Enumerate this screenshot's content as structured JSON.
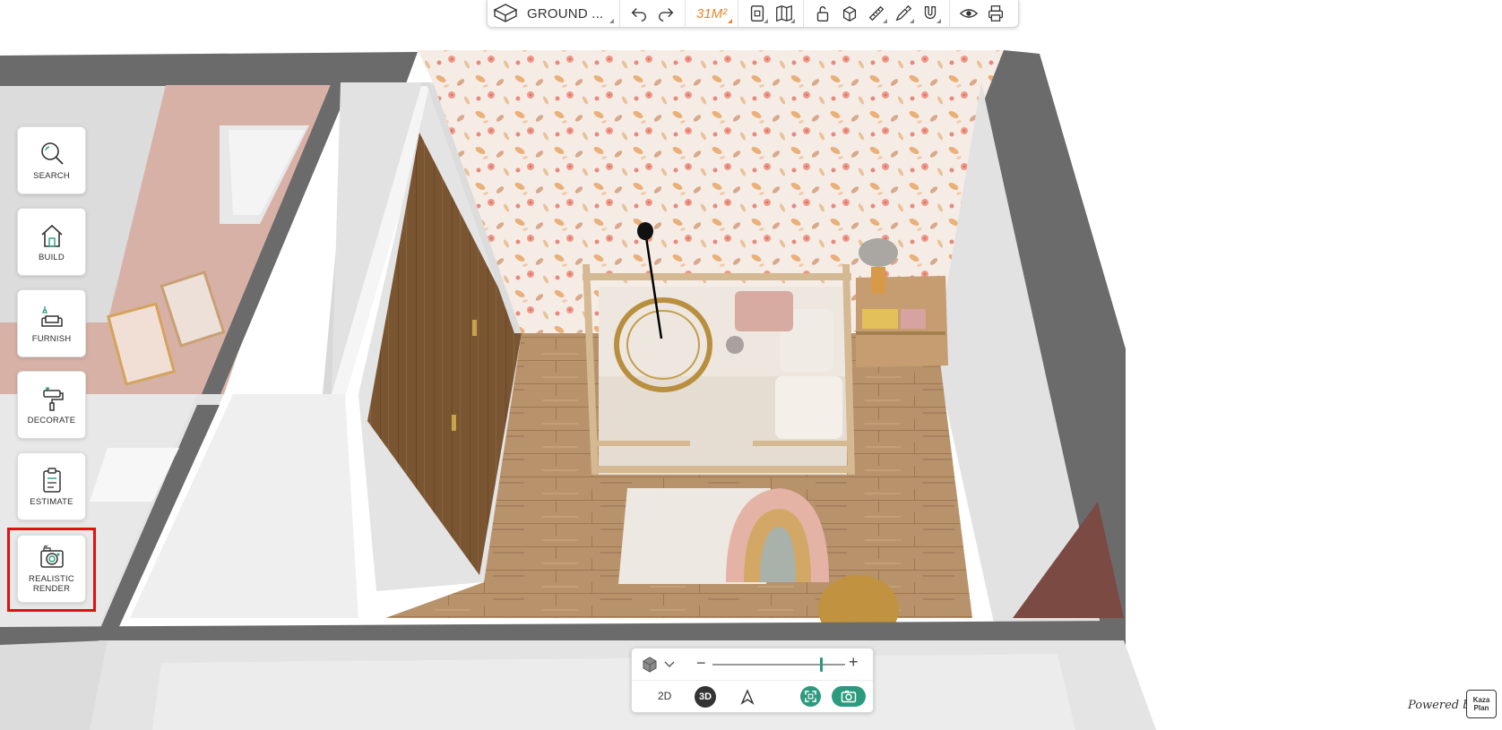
{
  "toolbar": {
    "floor_label": "GROUND ...",
    "area_label": "31M²",
    "icons": [
      "layers-icon",
      "undo-icon",
      "redo-icon",
      "save-icon",
      "map-icon",
      "unlock-icon",
      "cube-icon",
      "ruler-icon",
      "pipette-icon",
      "magnet-icon",
      "eye-icon",
      "print-icon"
    ]
  },
  "sidebar": {
    "items": [
      {
        "label": "SEARCH",
        "icon": "search-icon"
      },
      {
        "label": "BUILD",
        "icon": "house-icon"
      },
      {
        "label": "FURNISH",
        "icon": "sofa-icon"
      },
      {
        "label": "DECORATE",
        "icon": "paint-roller-icon"
      },
      {
        "label": "ESTIMATE",
        "icon": "clipboard-icon"
      },
      {
        "label": "REALISTIC\nRENDER",
        "label_line1": "REALISTIC",
        "label_line2": "RENDER",
        "icon": "camera-icon"
      }
    ]
  },
  "viewpanel": {
    "minus": "−",
    "plus": "+",
    "zoom_fraction": 0.82,
    "mode_2d": "2D",
    "mode_3d": "3D",
    "active_mode": "3D"
  },
  "footer": {
    "powered_by": "Powered by",
    "logo_text": "Kazaplan"
  },
  "colors": {
    "accent": "#2c9a7e",
    "area": "#e8862c",
    "highlight": "#e31010"
  }
}
